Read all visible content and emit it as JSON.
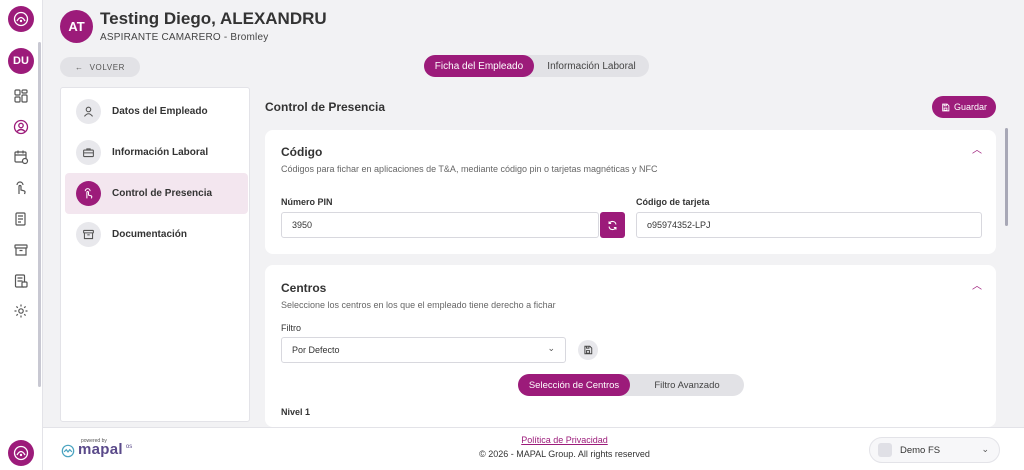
{
  "employee": {
    "initials": "AT",
    "name": "Testing Diego, ALEXANDRU",
    "role": "ASPIRANTE CAMARERO - Bromley"
  },
  "rail": {
    "user_initials": "DU",
    "icons": [
      "dashboard-icon",
      "user-circle-icon",
      "calendar-clock-icon",
      "hand-touch-icon",
      "document-list-icon",
      "archive-icon",
      "report-icon",
      "settings-icon"
    ]
  },
  "nav": {
    "back_label": "VOLVER"
  },
  "top_tabs": [
    {
      "label": "Ficha del Empleado",
      "active": true
    },
    {
      "label": "Información Laboral",
      "active": false
    }
  ],
  "menu": {
    "items": [
      {
        "label": "Datos del Empleado",
        "icon": "person-icon",
        "active": false
      },
      {
        "label": "Información Laboral",
        "icon": "briefcase-icon",
        "active": false
      },
      {
        "label": "Control de Presencia",
        "icon": "hand-touch-icon",
        "active": true
      },
      {
        "label": "Documentación",
        "icon": "archive-icon",
        "active": false
      }
    ]
  },
  "main": {
    "title": "Control de Presencia",
    "save_label": "Guardar"
  },
  "codigo_card": {
    "title": "Código",
    "description": "Códigos para fichar en aplicaciones de T&A, mediante código pin o tarjetas magnéticas y NFC",
    "pin_label": "Número PIN",
    "pin_value": "3950",
    "card_label": "Código de tarjeta",
    "card_value": "o95974352-LPJ"
  },
  "centros_card": {
    "title": "Centros",
    "description": "Seleccione los centros en los que el empleado tiene derecho a fichar",
    "filter_label": "Filtro",
    "filter_value": "Por Defecto",
    "subtabs": [
      {
        "label": "Selección de Centros",
        "active": true
      },
      {
        "label": "Filtro Avanzado",
        "active": false
      }
    ],
    "level_label": "Nivel 1"
  },
  "footer": {
    "powered_by": "powered by",
    "brand": "mapal",
    "brand_suffix": "os",
    "privacy_link": "Política de Privacidad",
    "copyright": "© 2026 - MAPAL Group. All rights reserved",
    "tenant": "Demo FS"
  },
  "colors": {
    "brand": "#9c1b7a",
    "background": "#f2f2f4"
  }
}
